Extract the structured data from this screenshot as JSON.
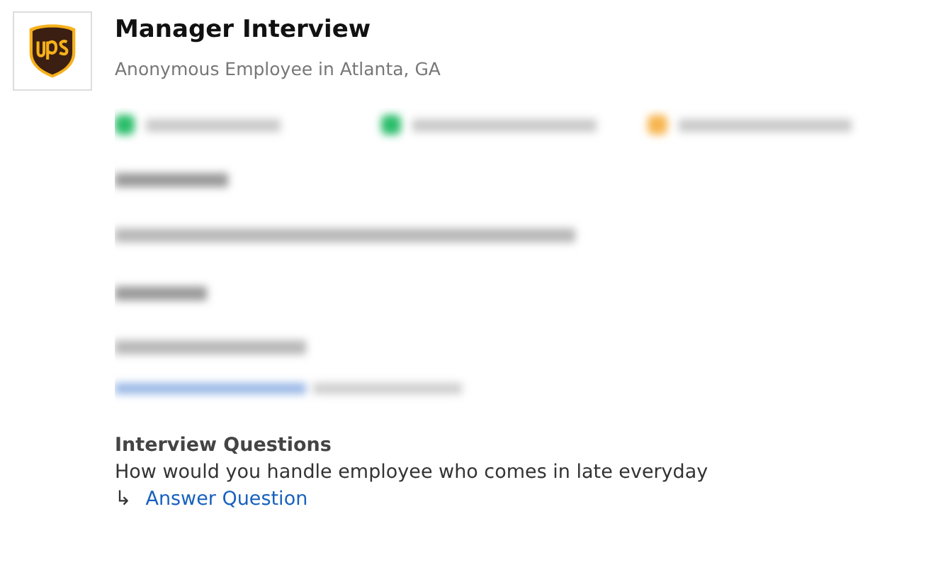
{
  "review": {
    "title": "Manager Interview",
    "author": "Anonymous Employee in Atlanta, GA"
  },
  "questions": {
    "heading": "Interview Questions",
    "items": [
      {
        "text": "How would you handle employee who comes in late everyday",
        "arrow": "↳",
        "link": "Answer Question"
      }
    ]
  }
}
